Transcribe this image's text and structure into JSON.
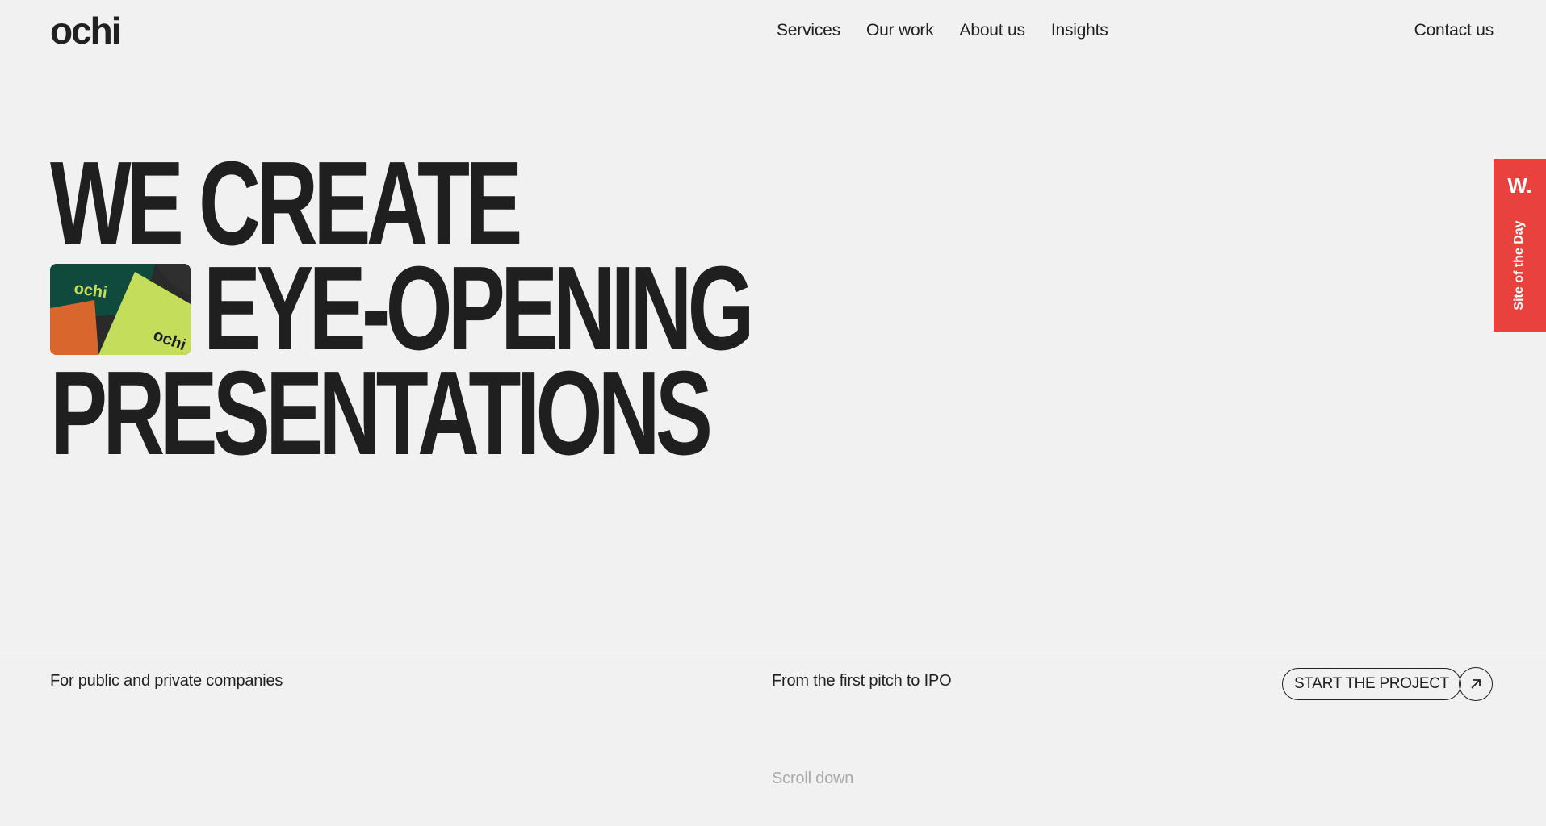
{
  "brand": {
    "name": "ochi"
  },
  "nav": {
    "links": [
      "Services",
      "Our work",
      "About us",
      "Insights"
    ],
    "contact": "Contact us"
  },
  "hero": {
    "line1": "WE CREATE",
    "line2": "EYE-OPENING",
    "line3": "PRESENTATIONS",
    "thumb_text_1": "ochi",
    "thumb_text_2": "ochi"
  },
  "footer": {
    "left": "For public and private companies",
    "middle": "From the first pitch to IPO",
    "cta_label": "START THE PROJECT",
    "cta_icon": "arrow-up-right-icon",
    "scroll_hint": "Scroll down"
  },
  "award": {
    "badge": "W.",
    "label": "Site of the Day"
  },
  "colors": {
    "background": "#f1f1f1",
    "text": "#212121",
    "award_red": "#e9413d",
    "thumb_green": "#0f4a3c",
    "thumb_lime": "#c4dd5a",
    "thumb_orange": "#d9672d"
  }
}
